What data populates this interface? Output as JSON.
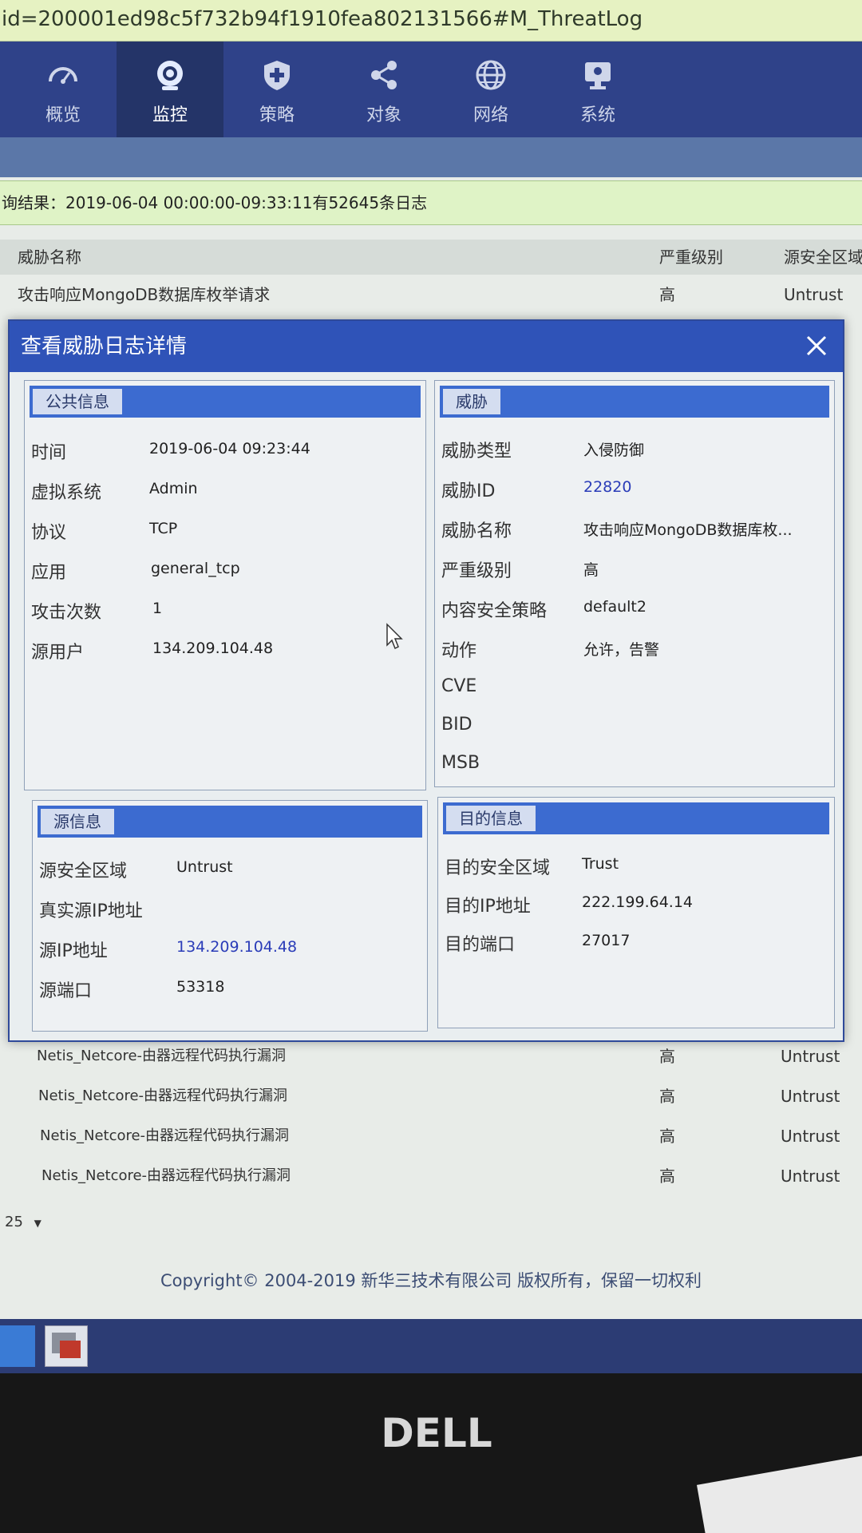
{
  "browser": {
    "url": "id=200001ed98c5f732b94f1910fea802131566#M_ThreatLog"
  },
  "nav": {
    "items": [
      {
        "label": "概览",
        "icon": "dashboard-icon"
      },
      {
        "label": "监控",
        "icon": "camera-icon"
      },
      {
        "label": "策略",
        "icon": "shield-plus-icon"
      },
      {
        "label": "对象",
        "icon": "share-nodes-icon"
      },
      {
        "label": "网络",
        "icon": "globe-icon"
      },
      {
        "label": "系统",
        "icon": "monitor-icon"
      }
    ],
    "active_index": 1
  },
  "query": {
    "result_text": "询结果：2019-06-04 00:00:00-09:33:11有52645条日志"
  },
  "table": {
    "headers": {
      "threat_name": "威胁名称",
      "severity": "严重级别",
      "src_zone": "源安全区域"
    },
    "first_row": {
      "threat_name": "攻击响应MongoDB数据库枚举请求",
      "severity": "高",
      "src_zone": "Untrust"
    },
    "rows_below": [
      {
        "threat_name": "Netis_Netcore-由器远程代码执行漏洞",
        "severity": "高",
        "src_zone": "Untrust"
      },
      {
        "threat_name": "Netis_Netcore-由器远程代码执行漏洞",
        "severity": "高",
        "src_zone": "Untrust"
      },
      {
        "threat_name": "Netis_Netcore-由器远程代码执行漏洞",
        "severity": "高",
        "src_zone": "Untrust"
      },
      {
        "threat_name": "Netis_Netcore-由器远程代码执行漏洞",
        "severity": "高",
        "src_zone": "Untrust"
      }
    ]
  },
  "modal": {
    "title": "查看威胁日志详情",
    "public_info": {
      "tab": "公共信息",
      "fields": [
        {
          "label": "时间",
          "value": "2019-06-04 09:23:44"
        },
        {
          "label": "虚拟系统",
          "value": "Admin"
        },
        {
          "label": "协议",
          "value": "TCP"
        },
        {
          "label": "应用",
          "value": "general_tcp"
        },
        {
          "label": "攻击次数",
          "value": "1"
        },
        {
          "label": "源用户",
          "value": "134.209.104.48"
        }
      ]
    },
    "threat": {
      "tab": "威胁",
      "fields": [
        {
          "label": "威胁类型",
          "value": "入侵防御"
        },
        {
          "label": "威胁ID",
          "value": "22820"
        },
        {
          "label": "威胁名称",
          "value": "攻击响应MongoDB数据库枚..."
        },
        {
          "label": "严重级别",
          "value": "高"
        },
        {
          "label": "内容安全策略",
          "value": "default2"
        },
        {
          "label": "动作",
          "value": "允许，告警"
        },
        {
          "label": "CVE",
          "value": ""
        },
        {
          "label": "BID",
          "value": ""
        },
        {
          "label": "MSB",
          "value": ""
        }
      ]
    },
    "source": {
      "tab": "源信息",
      "fields": [
        {
          "label": "源安全区域",
          "value": "Untrust"
        },
        {
          "label": "真实源IP地址",
          "value": ""
        },
        {
          "label": "源IP地址",
          "value": "134.209.104.48"
        },
        {
          "label": "源端口",
          "value": "53318"
        }
      ]
    },
    "destination": {
      "tab": "目的信息",
      "fields": [
        {
          "label": "目的安全区域",
          "value": "Trust"
        },
        {
          "label": "目的IP地址",
          "value": "222.199.64.14"
        },
        {
          "label": "目的端口",
          "value": "27017"
        }
      ]
    }
  },
  "pager": {
    "page_size": "25"
  },
  "footer": {
    "copyright": "Copyright© 2004-2019 新华三技术有限公司 版权所有，保留一切权利"
  },
  "monitor": {
    "brand": "DELL"
  },
  "colors": {
    "nav_bg": "#2f4289",
    "modal_title_bg": "#2f53b8",
    "panel_head": "#3c6bd0",
    "link": "#2a3cb8"
  }
}
